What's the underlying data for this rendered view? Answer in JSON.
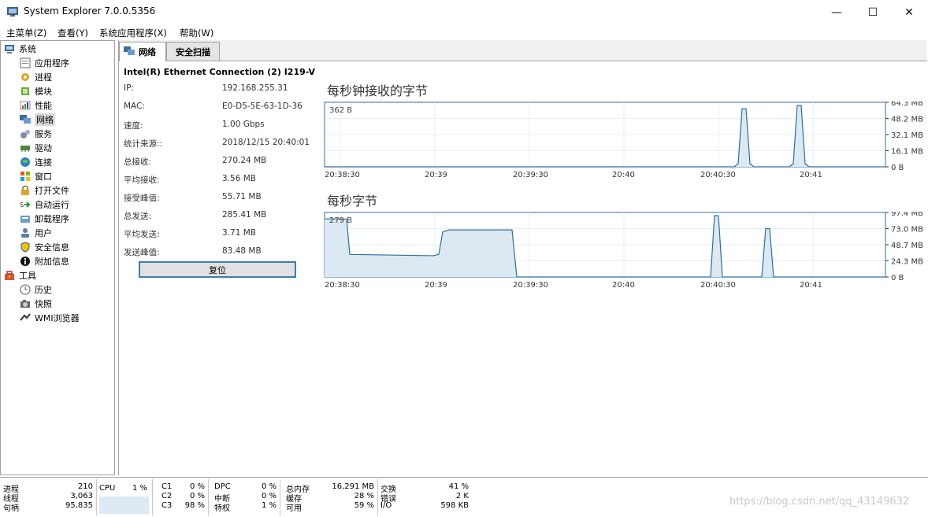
{
  "window": {
    "title": "System Explorer 7.0.0.5356",
    "minimize": "—",
    "maximize": "☐",
    "close": "✕"
  },
  "menu": [
    "主菜单(Z)",
    "查看(Y)",
    "系统应用程序(X)",
    "帮助(W)"
  ],
  "tree": {
    "system": "系统",
    "system_items": [
      "应用程序",
      "进程",
      "模块",
      "性能",
      "网络",
      "服务",
      "驱动",
      "连接",
      "窗口",
      "打开文件",
      "自动运行",
      "卸载程序",
      "用户",
      "安全信息",
      "附加信息"
    ],
    "selected": "网络",
    "tools": "工具",
    "tools_items": [
      "历史",
      "快照",
      "WMI浏览器"
    ]
  },
  "tabs": {
    "network": "网络",
    "security_scan": "安全扫描"
  },
  "adapter": {
    "name": "Intel(R) Ethernet Connection (2) I219-V",
    "props": [
      {
        "label": "IP:",
        "value": "192.168.255.31"
      },
      {
        "label": "MAC:",
        "value": "E0-D5-5E-63-1D-36"
      },
      {
        "label": "速度:",
        "value": "1.00 Gbps"
      },
      {
        "label": "统计来源::",
        "value": "2018/12/15 20:40:01"
      },
      {
        "label": "总接收:",
        "value": "270.24 MB"
      },
      {
        "label": "平均接收:",
        "value": "3.56 MB"
      },
      {
        "label": "接受峰值:",
        "value": "55.71 MB"
      },
      {
        "label": "总发送:",
        "value": "285.41 MB"
      },
      {
        "label": "平均发送:",
        "value": "3.71 MB"
      },
      {
        "label": "发送峰值:",
        "value": "83.48 MB"
      }
    ],
    "reset": "复位"
  },
  "charts": {
    "received": {
      "title": "每秒钟接收的字节",
      "current": "362 B",
      "yticks": [
        "64.3 MB",
        "48.2 MB",
        "32.1 MB",
        "16.1 MB",
        "0 B"
      ],
      "xticks": [
        "20:38:30",
        "20:39",
        "20:39:30",
        "20:40",
        "20:40:30",
        "20:41"
      ]
    },
    "total": {
      "title": "每秒字节",
      "current": "279 B",
      "yticks": [
        "97.4 MB",
        "73.0 MB",
        "48.7 MB",
        "24.3 MB",
        "0 B"
      ],
      "xticks": [
        "20:38:30",
        "20:39",
        "20:39:30",
        "20:40",
        "20:40:30",
        "20:41"
      ]
    }
  },
  "statusbar": {
    "col1": [
      [
        "进程",
        "210"
      ],
      [
        "线程",
        "3,063"
      ],
      [
        "句柄",
        "95,835"
      ]
    ],
    "cpu": {
      "label": "CPU",
      "value": "1 %"
    },
    "cstates": [
      [
        "C1",
        "0 %"
      ],
      [
        "C2",
        "0 %"
      ],
      [
        "C3",
        "98 %"
      ]
    ],
    "dpc": [
      [
        "DPC",
        "0 %"
      ],
      [
        "中断",
        "0 %"
      ],
      [
        "特权",
        "1 %"
      ]
    ],
    "mem": [
      [
        "总内存",
        "16,291 MB"
      ],
      [
        "缓存",
        "28 %"
      ],
      [
        "可用",
        "59 %"
      ]
    ],
    "swap": [
      [
        "交换",
        "41 %"
      ],
      [
        "错误",
        "2 K"
      ],
      [
        "I/O",
        "598 KB"
      ]
    ]
  },
  "watermark": "https://blog.csdn.net/qq_43149632",
  "colors": {
    "accent": "#3c7fb1",
    "chart_line": "#2b6f9e",
    "chart_fill": "#dce8f2",
    "grid": "#e6eef6"
  }
}
